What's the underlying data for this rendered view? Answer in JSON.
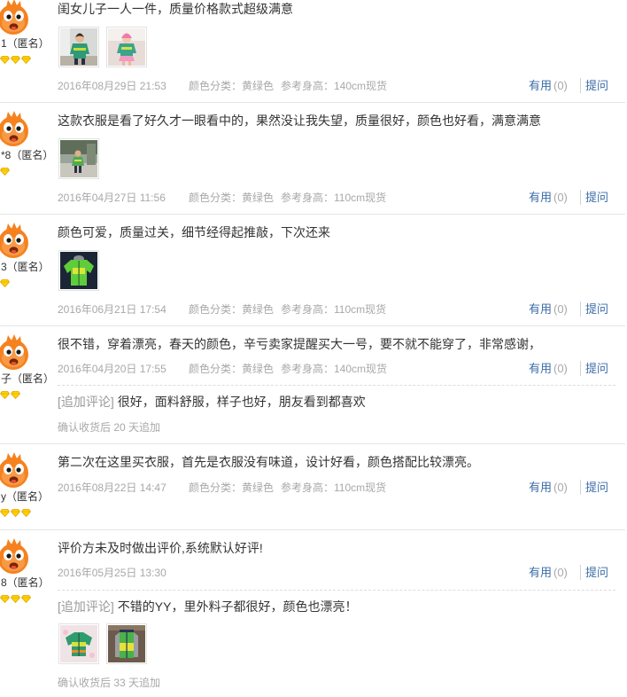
{
  "reviews": [
    {
      "user": {
        "name": "1（匿名）",
        "diamonds": 3
      },
      "text": "闺女儿子一人一件，质量价格款式超级满意",
      "date": "2016年08月29日 21:53",
      "color": "颜色分类：黄绿色",
      "height": "参考身高：140cm现货",
      "useful_label": "有用",
      "useful_count": "(0)",
      "ask_label": "提问"
    },
    {
      "user": {
        "name": "*8（匿名）",
        "diamonds": 1
      },
      "text": "这款衣服是看了好久才一眼看中的，果然没让我失望，质量很好，颜色也好看，满意满意",
      "date": "2016年04月27日 11:56",
      "color": "颜色分类：黄绿色",
      "height": "参考身高：110cm现货",
      "useful_label": "有用",
      "useful_count": "(0)",
      "ask_label": "提问"
    },
    {
      "user": {
        "name": "3（匿名）",
        "diamonds": 1
      },
      "text": "颜色可爱，质量过关，细节经得起推敲，下次还来",
      "date": "2016年06月21日 17:54",
      "color": "颜色分类：黄绿色",
      "height": "参考身高：110cm现货",
      "useful_label": "有用",
      "useful_count": "(0)",
      "ask_label": "提问"
    },
    {
      "user": {
        "name": "子（匿名）",
        "diamonds": 2
      },
      "text": "很不错，穿着漂亮，春天的颜色，辛亏卖家提醒买大一号，要不就不能穿了，非常感谢，",
      "date": "2016年04月20日 17:55",
      "color": "颜色分类：黄绿色",
      "height": "参考身高：140cm现货",
      "useful_label": "有用",
      "useful_count": "(0)",
      "ask_label": "提问",
      "append": {
        "label": "[追加评论]",
        "text": "很好，面料舒服，样子也好，朋友看到都喜欢",
        "note": "确认收货后 20 天追加"
      }
    },
    {
      "user": {
        "name": "y（匿名）",
        "diamonds": 3
      },
      "text": "第二次在这里买衣服，首先是衣服没有味道，设计好看，颜色搭配比较漂亮。",
      "date": "2016年08月22日 14:47",
      "color": "颜色分类：黄绿色",
      "height": "参考身高：110cm现货",
      "useful_label": "有用",
      "useful_count": "(0)",
      "ask_label": "提问"
    },
    {
      "user": {
        "name": "8（匿名）",
        "diamonds": 3
      },
      "text": "评价方未及时做出评价,系统默认好评!",
      "date": "2016年05月25日 13:30",
      "useful_label": "有用",
      "useful_count": "(0)",
      "ask_label": "提问",
      "append": {
        "label": "[追加评论]",
        "text": "不错的YY，里外料子都很好，颜色也漂亮！",
        "note": "确认收货后 33 天追加"
      }
    }
  ],
  "icons": {
    "avatar": "avatar-icon",
    "credit_badge": "diamond-icon"
  },
  "colors": {
    "text": "#333333",
    "meta": "#a8a8a8",
    "link": "#3b6ca8",
    "avatar": "#f5821f",
    "badge": "#ffd200",
    "divider": "#e5e5e5"
  }
}
